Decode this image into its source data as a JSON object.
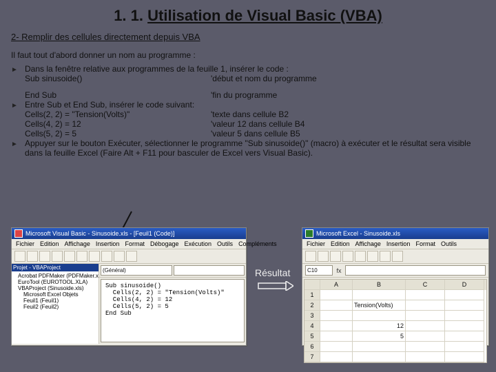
{
  "title_prefix": "1. 1.",
  "title_main": "Utilisation de Visual Basic (VBA)",
  "subtitle": "2- Remplir des cellules directement depuis VBA",
  "intro": "Il faut tout d'abord donner un nom au programme :",
  "b1": {
    "lead": "Dans la fenêtre relative aux programmes de la feuille 1, insérer le code :",
    "l1a": "Sub sinusoide()",
    "l1b": "'début et nom du programme",
    "l2a": "End Sub",
    "l2b": "'fin du programme"
  },
  "b2": {
    "lead": "Entre Sub et End Sub, insérer le code suivant:",
    "r1a": "Cells(2, 2) = \"Tension(Volts)\"",
    "r1b": "'texte dans cellule B2",
    "r2a": "Cells(4, 2) = 12",
    "r2b": "'valeur 12 dans cellule B4",
    "r3a": "Cells(5, 2) = 5",
    "r3b": "'valeur 5 dans cellule B5"
  },
  "b3": "Appuyer sur le bouton Exécuter, sélectionner le programme \"Sub sinusoide()\" (macro) à exécuter et le résultat sera visible dans la feuille Excel (Faire Alt + F11 pour basculer de Excel vers Visual Basic).",
  "result_label": "Résultat",
  "vba": {
    "title": "Microsoft Visual Basic - Sinusoide.xls - [Feuil1 (Code)]",
    "menus": [
      "Fichier",
      "Edition",
      "Affichage",
      "Insertion",
      "Format",
      "Débogage",
      "Exécution",
      "Outils",
      "Compléments"
    ],
    "proj_head": "Projet - VBAProject",
    "proj": [
      "Acrobat PDFMaker (PDFMaker.xla)",
      "EuroTool (EUROTOOL.XLA)",
      "VBAProject (Sinusoide.xls)",
      "Microsoft Excel Objets",
      "Feuil1 (Feuil1)",
      "Feuil2 (Feuil2)"
    ],
    "dd_left": "(Général)",
    "code": "Sub sinusoide()\n  Cells(2, 2) = \"Tension(Volts)\"\n  Cells(4, 2) = 12\n  Cells(5, 2) = 5\nEnd Sub"
  },
  "excel": {
    "title": "Microsoft Excel - Sinusoide.xls",
    "menus": [
      "Fichier",
      "Edition",
      "Affichage",
      "Insertion",
      "Format",
      "Outils"
    ],
    "namebox": "C10",
    "cols": [
      "A",
      "B",
      "C",
      "D"
    ],
    "rows": [
      {
        "n": "1",
        "B": ""
      },
      {
        "n": "2",
        "B": "Tension(Volts)"
      },
      {
        "n": "3",
        "B": ""
      },
      {
        "n": "4",
        "B": "12",
        "num": true
      },
      {
        "n": "5",
        "B": "5",
        "num": true
      },
      {
        "n": "6",
        "B": ""
      },
      {
        "n": "7",
        "B": ""
      }
    ]
  }
}
